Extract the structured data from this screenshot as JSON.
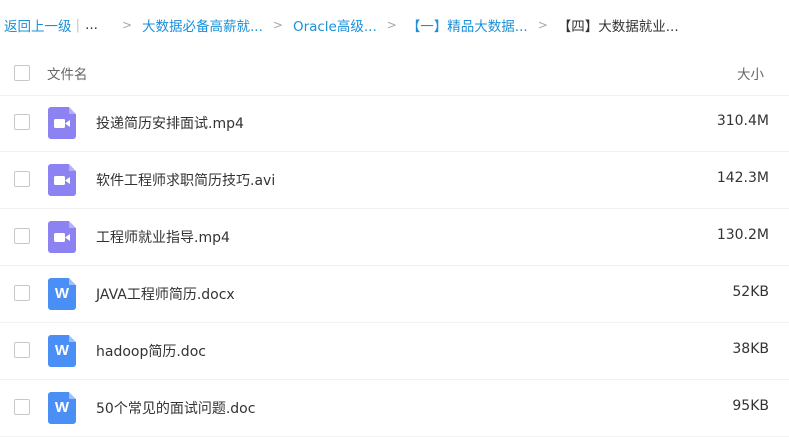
{
  "breadcrumb": {
    "back": "返回上一级",
    "separator": "|",
    "ellipsis": "...",
    "arrow": ">",
    "crumbs": [
      "大数据必备高薪就...",
      "Oracle高级...",
      "【一】精品大数据...",
      "【四】大数据就业..."
    ]
  },
  "header": {
    "name_label": "文件名",
    "size_label": "大小"
  },
  "files": [
    {
      "name": "投递简历安排面试.mp4",
      "size": "310.4M",
      "type": "video"
    },
    {
      "name": "软件工程师求职简历技巧.avi",
      "size": "142.3M",
      "type": "video"
    },
    {
      "name": "工程师就业指导.mp4",
      "size": "130.2M",
      "type": "video"
    },
    {
      "name": "JAVA工程师简历.docx",
      "size": "52KB",
      "type": "word",
      "icon_letter": "W"
    },
    {
      "name": "hadoop简历.doc",
      "size": "38KB",
      "type": "word",
      "icon_letter": "W"
    },
    {
      "name": "50个常见的面试问题.doc",
      "size": "95KB",
      "type": "word",
      "icon_letter": "W"
    }
  ],
  "colors": {
    "link": "#1a90d9",
    "video_icon": "#8c82f2",
    "word_icon": "#4a8ff5"
  }
}
